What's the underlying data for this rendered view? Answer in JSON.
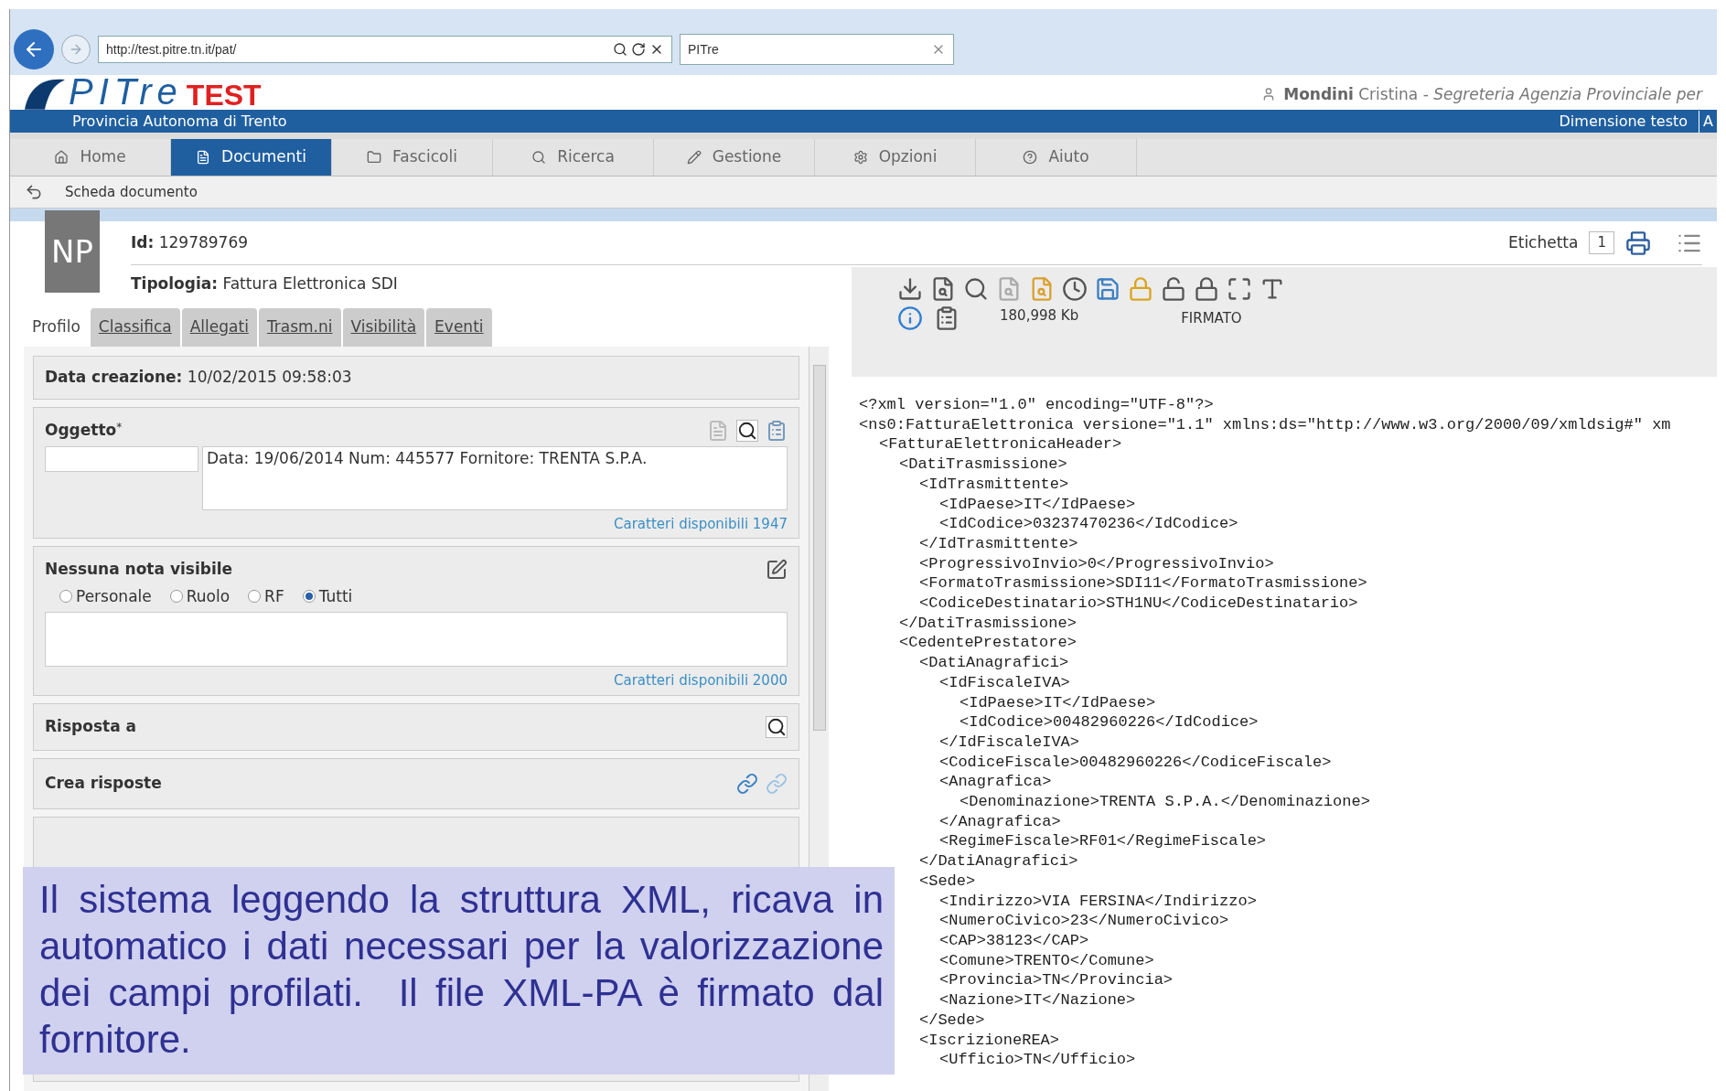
{
  "browser": {
    "address": "http://test.pitre.tn.it/pat/",
    "tab_title": "PITre"
  },
  "header": {
    "logo": "PITre",
    "logo_badge": "TEST",
    "organization": "Provincia Autonoma di Trento",
    "user_surname": "Mondini",
    "user_rest": "Cristina - ",
    "user_office": "Segreteria Agenzia Provinciale per",
    "text_size_label": "Dimensione testo",
    "text_size_button": "A"
  },
  "nav": [
    {
      "label": "Home",
      "selected": false
    },
    {
      "label": "Documenti",
      "selected": true
    },
    {
      "label": "Fascicoli",
      "selected": false
    },
    {
      "label": "Ricerca",
      "selected": false
    },
    {
      "label": "Gestione",
      "selected": false
    },
    {
      "label": "Opzioni",
      "selected": false
    },
    {
      "label": "Aiuto",
      "selected": false
    }
  ],
  "breadcrumb": "Scheda documento",
  "document": {
    "badge": "NP",
    "id_label": "Id:",
    "id": "129789769",
    "type_label": "Tipologia:",
    "type": "Fattura Elettronica SDI",
    "label_label": "Etichetta",
    "label_count": "1"
  },
  "tabs": [
    {
      "label": "Profilo",
      "selected": true
    },
    {
      "label": "Classifica",
      "selected": false
    },
    {
      "label": "Allegati",
      "selected": false
    },
    {
      "label": "Trasm.ni",
      "selected": false
    },
    {
      "label": "Visibilità",
      "selected": false
    },
    {
      "label": "Eventi",
      "selected": false
    }
  ],
  "profile": {
    "created_label": "Data creazione:",
    "created": "10/02/2015 09:58:03",
    "subject_label": "Oggetto",
    "required_mark": "*",
    "subject": "Data: 19/06/2014 Num: 445577 Fornitore: TRENTA S.P.A.",
    "subject_chars": "Caratteri disponibili 1947",
    "note_label": "Nessuna nota visibile",
    "note_scopes": [
      {
        "label": "Personale",
        "selected": false
      },
      {
        "label": "Ruolo",
        "selected": false
      },
      {
        "label": "RF",
        "selected": false
      },
      {
        "label": "Tutti",
        "selected": true
      }
    ],
    "note_chars": "Caratteri disponibili 2000",
    "reply_to_label": "Risposta a",
    "create_replies_label": "Crea risposte"
  },
  "viewer": {
    "size": "180,998 Kb",
    "status": "FIRMATO",
    "xml": [
      {
        "line": "<?xml version=\"1.0\" encoding=\"UTF-8\"?>"
      },
      {
        "line": "<ns0:FatturaElettronica versione=\"1.1\" xmlns:ds=\"http://www.w3.org/2000/09/xmldsig#\" xm",
        "children": [
          {
            "line": "<FatturaElettronicaHeader>",
            "children": [
              {
                "line": "<DatiTrasmissione>",
                "children": [
                  {
                    "line": "<IdTrasmittente>",
                    "children": [
                      {
                        "line": "<IdPaese>IT</IdPaese>"
                      },
                      {
                        "line": "<IdCodice>03237470236</IdCodice>"
                      }
                    ]
                  },
                  {
                    "line": "</IdTrasmittente>"
                  },
                  {
                    "line": "<ProgressivoInvio>0</ProgressivoInvio>"
                  },
                  {
                    "line": "<FormatoTrasmissione>SDI11</FormatoTrasmissione>"
                  },
                  {
                    "line": "<CodiceDestinatario>STH1NU</CodiceDestinatario>"
                  }
                ]
              },
              {
                "line": "</DatiTrasmissione>"
              },
              {
                "line": "<CedentePrestatore>",
                "children": [
                  {
                    "line": "<DatiAnagrafici>",
                    "children": [
                      {
                        "line": "<IdFiscaleIVA>",
                        "children": [
                          {
                            "line": "<IdPaese>IT</IdPaese>"
                          },
                          {
                            "line": "<IdCodice>00482960226</IdCodice>"
                          }
                        ]
                      },
                      {
                        "line": "</IdFiscaleIVA>"
                      },
                      {
                        "line": "<CodiceFiscale>00482960226</CodiceFiscale>"
                      },
                      {
                        "line": "<Anagrafica>",
                        "children": [
                          {
                            "line": "<Denominazione>TRENTA S.P.A.</Denominazione>"
                          }
                        ]
                      },
                      {
                        "line": "</Anagrafica>"
                      },
                      {
                        "line": "<RegimeFiscale>RF01</RegimeFiscale>"
                      }
                    ]
                  },
                  {
                    "line": "</DatiAnagrafici>"
                  },
                  {
                    "line": "<Sede>",
                    "children": [
                      {
                        "line": "<Indirizzo>VIA FERSINA</Indirizzo>"
                      },
                      {
                        "line": "<NumeroCivico>23</NumeroCivico>"
                      },
                      {
                        "line": "<CAP>38123</CAP>"
                      },
                      {
                        "line": "<Comune>TRENTO</Comune>"
                      },
                      {
                        "line": "<Provincia>TN</Provincia>"
                      },
                      {
                        "line": "<Nazione>IT</Nazione>"
                      }
                    ]
                  },
                  {
                    "line": "</Sede>"
                  },
                  {
                    "line": "<IscrizioneREA>",
                    "children": [
                      {
                        "line": "<Ufficio>TN</Ufficio>"
                      }
                    ]
                  }
                ]
              }
            ]
          }
        ]
      }
    ]
  },
  "caption": "Il sistema leggendo la struttura XML, ricava in automatico i dati necessari per la valorizzazione dei campi profilati.  Il file XML-PA è firmato dal fornitore."
}
